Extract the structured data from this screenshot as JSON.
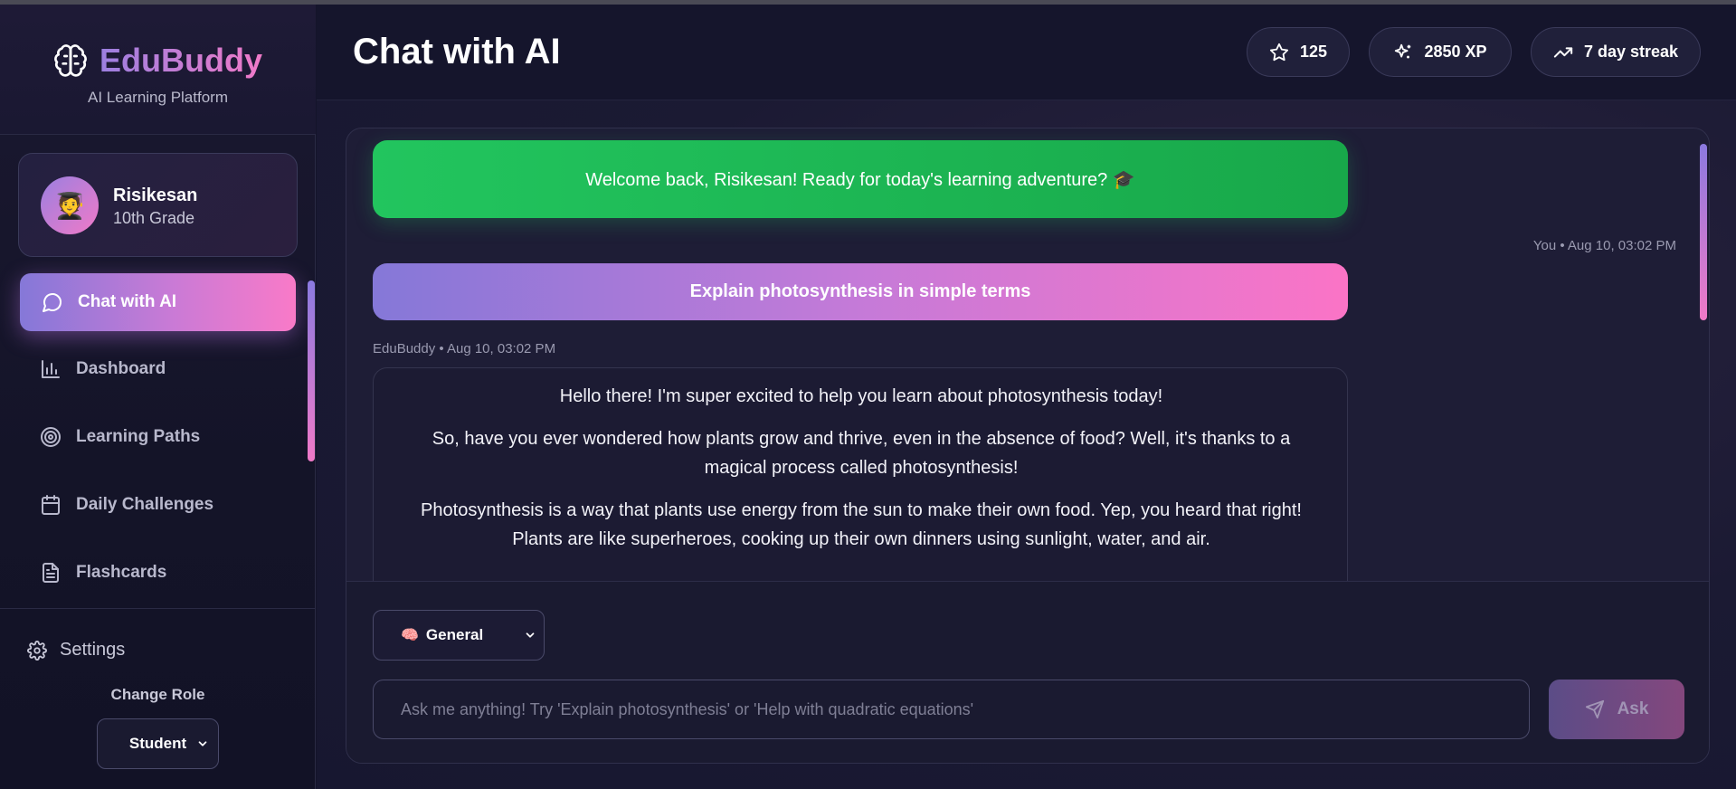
{
  "brand": {
    "name": "EduBuddy",
    "subtitle": "AI Learning Platform",
    "icon": "brain-icon"
  },
  "profile": {
    "name": "Risikesan",
    "grade": "10th Grade",
    "avatar_icon": "graduate-icon"
  },
  "sidebar": {
    "items": [
      {
        "label": "Chat with AI",
        "icon": "chat-bubble-icon",
        "active": true
      },
      {
        "label": "Dashboard",
        "icon": "bar-chart-icon",
        "active": false
      },
      {
        "label": "Learning Paths",
        "icon": "target-icon",
        "active": false
      },
      {
        "label": "Daily Challenges",
        "icon": "calendar-icon",
        "active": false
      },
      {
        "label": "Flashcards",
        "icon": "document-icon",
        "active": false
      }
    ],
    "settings_label": "Settings",
    "change_role_label": "Change Role",
    "role_value": "Student"
  },
  "header": {
    "title": "Chat with AI",
    "stats": [
      {
        "value": "125",
        "icon": "star-icon"
      },
      {
        "value": "2850 XP",
        "icon": "sparkle-icon"
      },
      {
        "value": "7 day streak",
        "icon": "trending-up-icon"
      }
    ]
  },
  "chat": {
    "welcome": "Welcome back, Risikesan! Ready for today's learning adventure? 🎓",
    "user_meta": "You • Aug 10, 03:02 PM",
    "user_message": "Explain photosynthesis in simple terms",
    "bot_meta": "EduBuddy • Aug 10, 03:02 PM",
    "bot_paragraphs": [
      "Hello there! I'm super excited to help you learn about photosynthesis today!",
      "So, have you ever wondered how plants grow and thrive, even in the absence of food? Well, it's thanks to a magical process called photosynthesis!",
      "Photosynthesis is a way that plants use energy from the sun to make their own food. Yep, you heard that right! Plants are like superheroes, cooking up their own dinners using sunlight, water, and air."
    ]
  },
  "composer": {
    "mode_emoji": "🧠",
    "mode_value": "General",
    "placeholder": "Ask me anything! Try 'Explain photosynthesis' or 'Help with quadratic equations'",
    "ask_label": "Ask"
  },
  "colors": {
    "accent_start": "#8578d8",
    "accent_end": "#fb74c6",
    "success": "#22c55e",
    "background": "#14142a"
  }
}
